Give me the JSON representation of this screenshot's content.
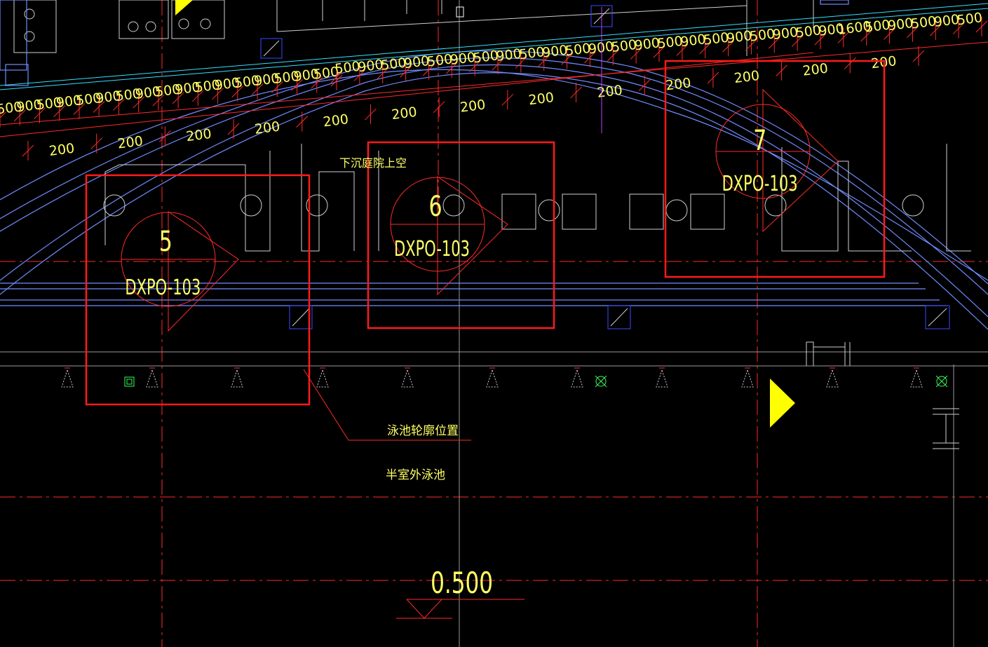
{
  "colors": {
    "background": "#000000",
    "dimension_red": "#ff2a2a",
    "dimension_text": "#ffff66",
    "pipe_blue": "#6f8cff",
    "wall_grey": "#cfcfcf",
    "highlight_box": "#ff1a1a",
    "accent_yellow": "#ffff00",
    "cyan": "#35e0ff",
    "green_symbol": "#35ff55",
    "magenta_line": "#c040ff"
  },
  "dimensions_top": [
    "500",
    "900",
    "500",
    "900",
    "500",
    "900",
    "500",
    "900",
    "500",
    "900",
    "500",
    "900",
    "500",
    "900",
    "500",
    "900",
    "500",
    "900",
    "500",
    "900",
    "500",
    "900",
    "1600",
    "500",
    "900",
    "500",
    "900",
    "500"
  ],
  "dimensions_bottom": [
    "500",
    "900",
    "500",
    "900",
    "500",
    "900",
    "500",
    "900",
    "500",
    "900",
    "500",
    "900",
    "500",
    "900",
    "500",
    "900",
    "500"
  ],
  "dimensions_200": [
    "200",
    "200",
    "200",
    "200",
    "200",
    "200",
    "200",
    "200",
    "200",
    "200",
    "200",
    "200",
    "200"
  ],
  "detail_callouts": [
    {
      "number": "5",
      "sheet": "DXPO-103"
    },
    {
      "number": "6",
      "sheet": "DXPO-103"
    },
    {
      "number": "7",
      "sheet": "DXPO-103"
    }
  ],
  "labels": {
    "sunken_courtyard": "下沉庭院上空",
    "pool_outline": "泳池轮廓位置",
    "semi_outdoor_pool": "半室外泳池"
  },
  "elevation": {
    "value": "0.500"
  },
  "icons": {
    "section_marker": "section-arrow-icon",
    "drain": "floor-drain-icon",
    "sprinkler": "sprinkler-head-icon",
    "valve": "valve-icon",
    "pump": "pump-icon"
  }
}
